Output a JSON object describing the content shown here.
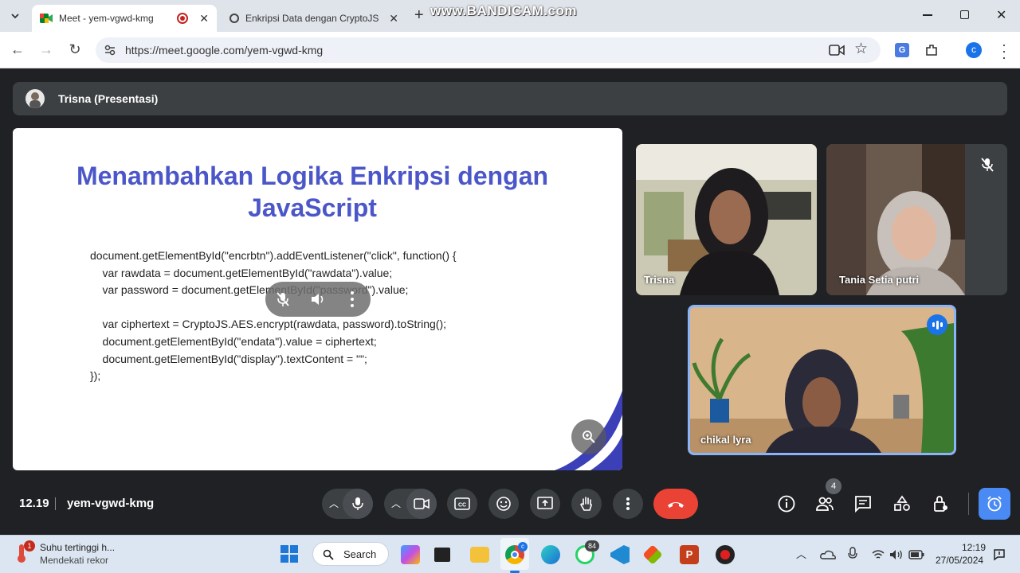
{
  "browser": {
    "tabs": [
      {
        "title": "Meet - yem-vgwd-kmg"
      },
      {
        "title": "Enkripsi Data dengan CryptoJS"
      }
    ],
    "watermark": "www.BANDICAM.com",
    "url": "https://meet.google.com/yem-vgwd-kmg",
    "profile_initial": "c"
  },
  "meet": {
    "presenter_label": "Trisna (Presentasi)",
    "slide": {
      "title": "Menambahkan Logika Enkripsi dengan JavaScript",
      "code": "document.getElementById(\"encrbtn\").addEventListener(\"click\", function() {\n    var rawdata = document.getElementById(\"rawdata\").value;\n    var password = document.getElementById(\"password\").value;\n\n    var ciphertext = CryptoJS.AES.encrypt(rawdata, password).toString();\n    document.getElementById(\"endata\").value = ciphertext;\n    document.getElementById(\"display\").textContent = \"\";\n});"
    },
    "participants": [
      {
        "name": "Trisna"
      },
      {
        "name": "Tania Setia putri"
      },
      {
        "name": "chikal lyra"
      }
    ],
    "time": "12.19",
    "meeting_code": "yem-vgwd-kmg",
    "people_count": "4",
    "colors": {
      "accent": "#8ab4f8",
      "end_call": "#ea4335",
      "slide_title": "#4b57c8"
    }
  },
  "taskbar": {
    "weather_title": "Suhu tertinggi h...",
    "weather_sub": "Mendekati rekor",
    "weather_badge": "1",
    "search_label": "Search",
    "chrome_badge": "c",
    "whatsapp_badge": "84",
    "clock_time": "12:19",
    "clock_date": "27/05/2024"
  }
}
